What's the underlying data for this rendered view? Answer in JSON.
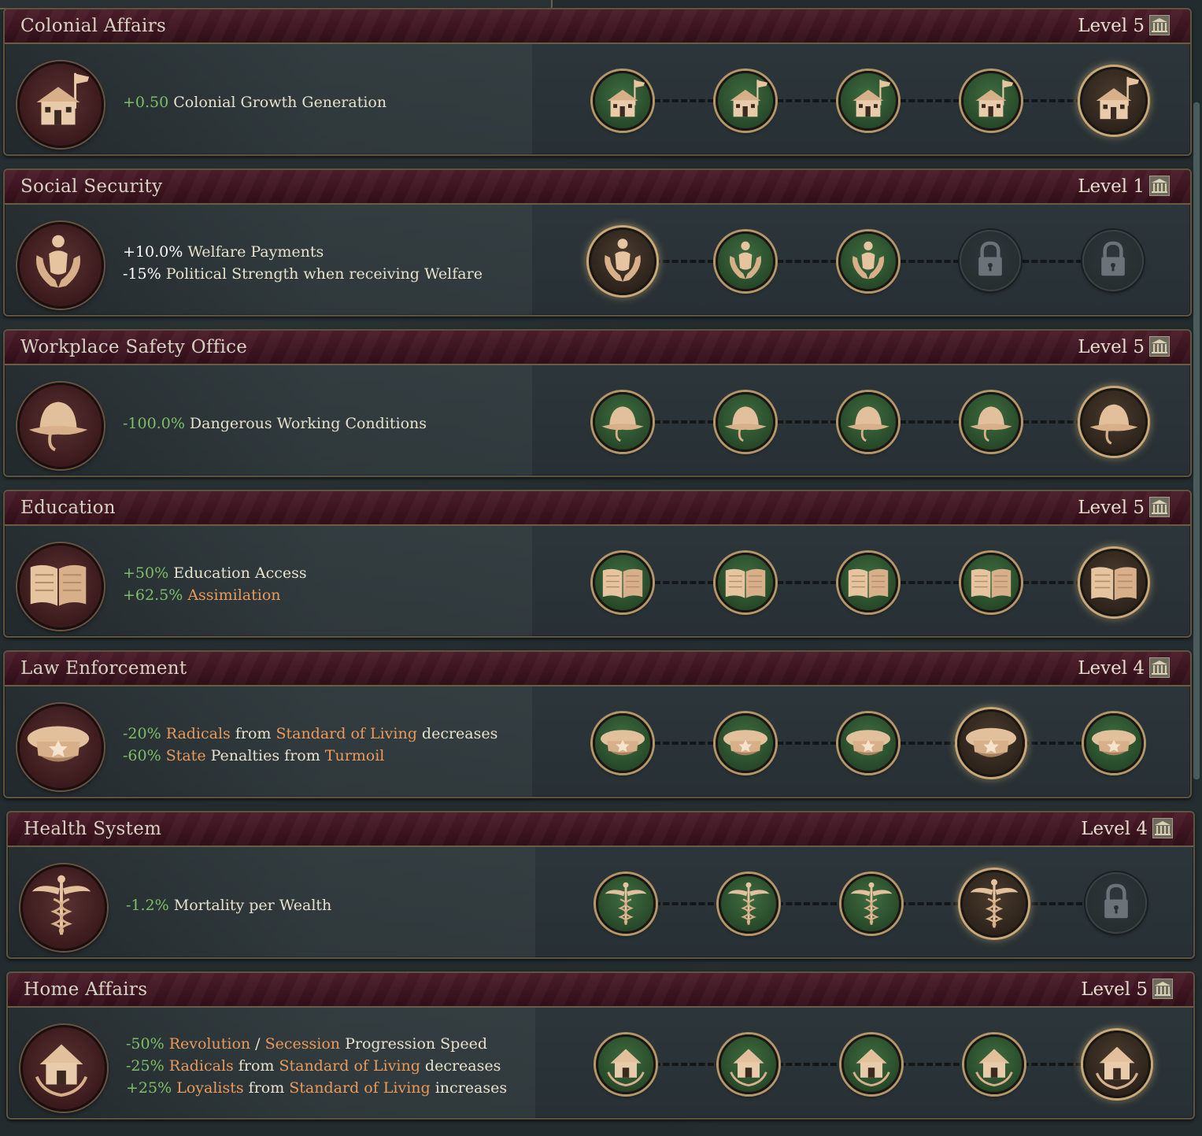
{
  "panels": [
    {
      "title": "Colonial Affairs",
      "level": "Level 5",
      "icon": "colony-house-icon",
      "effects": [
        [
          {
            "t": "+0.50 ",
            "c": "g"
          },
          {
            "t": "Colonial Growth Generation",
            "c": ""
          }
        ]
      ],
      "nodes": [
        "normal",
        "normal",
        "normal",
        "normal",
        "current"
      ]
    },
    {
      "title": "Social Security",
      "level": "Level 1",
      "icon": "welfare-hands-icon",
      "effects": [
        [
          {
            "t": "+10.0% ",
            "c": "w"
          },
          {
            "t": "Welfare Payments",
            "c": ""
          }
        ],
        [
          {
            "t": "-15% ",
            "c": "w"
          },
          {
            "t": "Political Strength when receiving Welfare",
            "c": ""
          }
        ]
      ],
      "nodes": [
        "current",
        "normal",
        "normal",
        "locked",
        "locked"
      ]
    },
    {
      "title": "Workplace Safety Office",
      "level": "Level 5",
      "icon": "safety-helmet-icon",
      "effects": [
        [
          {
            "t": "-100.0% ",
            "c": "g"
          },
          {
            "t": "Dangerous Working Conditions",
            "c": ""
          }
        ]
      ],
      "nodes": [
        "normal",
        "normal",
        "normal",
        "normal",
        "current"
      ]
    },
    {
      "title": "Education",
      "level": "Level 5",
      "icon": "open-book-icon",
      "effects": [
        [
          {
            "t": "+50% ",
            "c": "g"
          },
          {
            "t": "Education Access",
            "c": ""
          }
        ],
        [
          {
            "t": "+62.5% ",
            "c": "g"
          },
          {
            "t": "Assimilation",
            "c": "o"
          }
        ]
      ],
      "nodes": [
        "normal",
        "normal",
        "normal",
        "normal",
        "current"
      ]
    },
    {
      "title": "Law Enforcement",
      "level": "Level 4",
      "icon": "police-cap-icon",
      "effects": [
        [
          {
            "t": "-20% ",
            "c": "g"
          },
          {
            "t": "Radicals",
            "c": "o"
          },
          {
            "t": " from ",
            "c": ""
          },
          {
            "t": "Standard of Living",
            "c": "o"
          },
          {
            "t": " decreases",
            "c": ""
          }
        ],
        [
          {
            "t": "-60% ",
            "c": "g"
          },
          {
            "t": "State",
            "c": "o"
          },
          {
            "t": " Penalties from ",
            "c": ""
          },
          {
            "t": "Turmoil",
            "c": "o"
          }
        ]
      ],
      "nodes": [
        "normal",
        "normal",
        "normal",
        "current",
        "normal"
      ]
    },
    {
      "title": "Health System",
      "level": "Level 4",
      "icon": "caduceus-icon",
      "effects": [
        [
          {
            "t": "-1.2% ",
            "c": "g"
          },
          {
            "t": "Mortality per Wealth",
            "c": ""
          }
        ]
      ],
      "nodes": [
        "normal",
        "normal",
        "normal",
        "current",
        "locked"
      ]
    },
    {
      "title": "Home Affairs",
      "level": "Level 5",
      "icon": "home-wreath-icon",
      "effects": [
        [
          {
            "t": "-50% ",
            "c": "g"
          },
          {
            "t": "Revolution",
            "c": "o"
          },
          {
            "t": " / ",
            "c": ""
          },
          {
            "t": "Secession",
            "c": "o"
          },
          {
            "t": " Progression Speed",
            "c": ""
          }
        ],
        [
          {
            "t": "-25% ",
            "c": "g"
          },
          {
            "t": "Radicals",
            "c": "o"
          },
          {
            "t": " from ",
            "c": ""
          },
          {
            "t": "Standard of Living",
            "c": "o"
          },
          {
            "t": " decreases",
            "c": ""
          }
        ],
        [
          {
            "t": "+25% ",
            "c": "g"
          },
          {
            "t": "Loyalists",
            "c": "o"
          },
          {
            "t": " from ",
            "c": ""
          },
          {
            "t": "Standard of Living",
            "c": "o"
          },
          {
            "t": " increases",
            "c": ""
          }
        ]
      ],
      "nodes": [
        "normal",
        "normal",
        "normal",
        "normal",
        "current"
      ]
    }
  ],
  "colors": {
    "positive": "#7fbe68",
    "highlight": "#e99a5c",
    "header_bg": "#3d1521",
    "node_green": "#3e6d40"
  }
}
